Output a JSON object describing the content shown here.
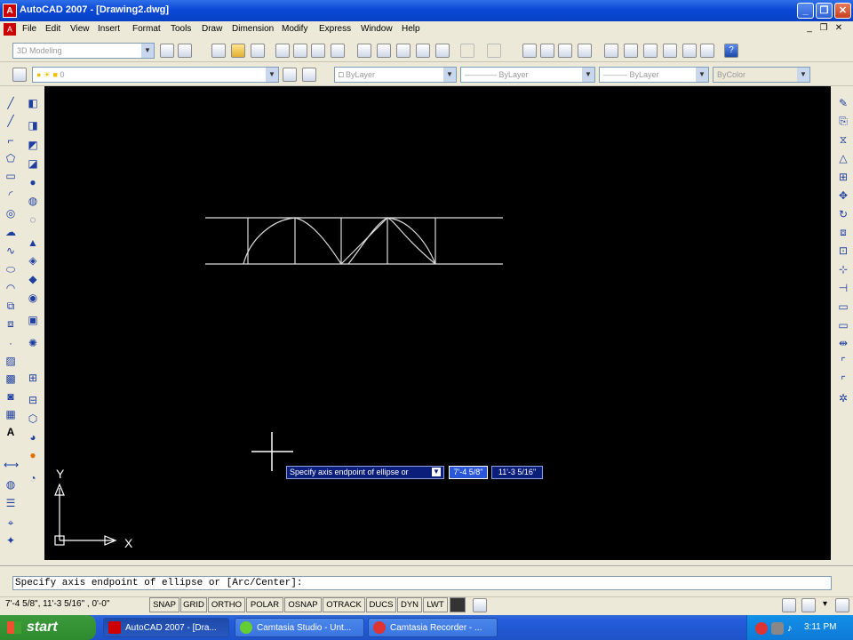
{
  "window": {
    "title": "AutoCAD 2007 - [Drawing2.dwg]",
    "app_icon": "autocad-logo-icon",
    "controls": [
      "minimize",
      "restore",
      "close"
    ]
  },
  "menubar": {
    "items": [
      "File",
      "Edit",
      "View",
      "Insert",
      "Format",
      "Tools",
      "Draw",
      "Dimension",
      "Modify",
      "Express",
      "Window",
      "Help"
    ]
  },
  "toolbar": {
    "workspace": "3D Modeling",
    "layer": "0",
    "color": "ByLayer",
    "linetype": "ByLayer",
    "lineweight": "ByLayer",
    "plotstyle": "ByColor"
  },
  "dynamic_input": {
    "prompt": "Specify axis endpoint of ellipse or",
    "value1": "7'-4 5/8\"",
    "value2": "11'-3 5/16\""
  },
  "ucs": {
    "y_label": "Y",
    "x_label": "X"
  },
  "command_line": {
    "text": "Specify axis endpoint of ellipse or [Arc/Center]:"
  },
  "status": {
    "coords": "7'-4 5/8\",   11'-3 5/16\" , 0'-0\"",
    "buttons": [
      "SNAP",
      "GRID",
      "ORTHO",
      "POLAR",
      "OSNAP",
      "OTRACK",
      "DUCS",
      "DYN",
      "LWT"
    ]
  },
  "taskbar": {
    "start": "start",
    "tasks": [
      "AutoCAD 2007 - [Dra...",
      "Camtasia Studio - Unt...",
      "Camtasia Recorder - ..."
    ],
    "clock": "3:11 PM"
  },
  "colors": {
    "canvas": "#000000",
    "title": "#0a49d6",
    "taskbar": "#245edc",
    "tooltip": "#0b1e7a"
  }
}
